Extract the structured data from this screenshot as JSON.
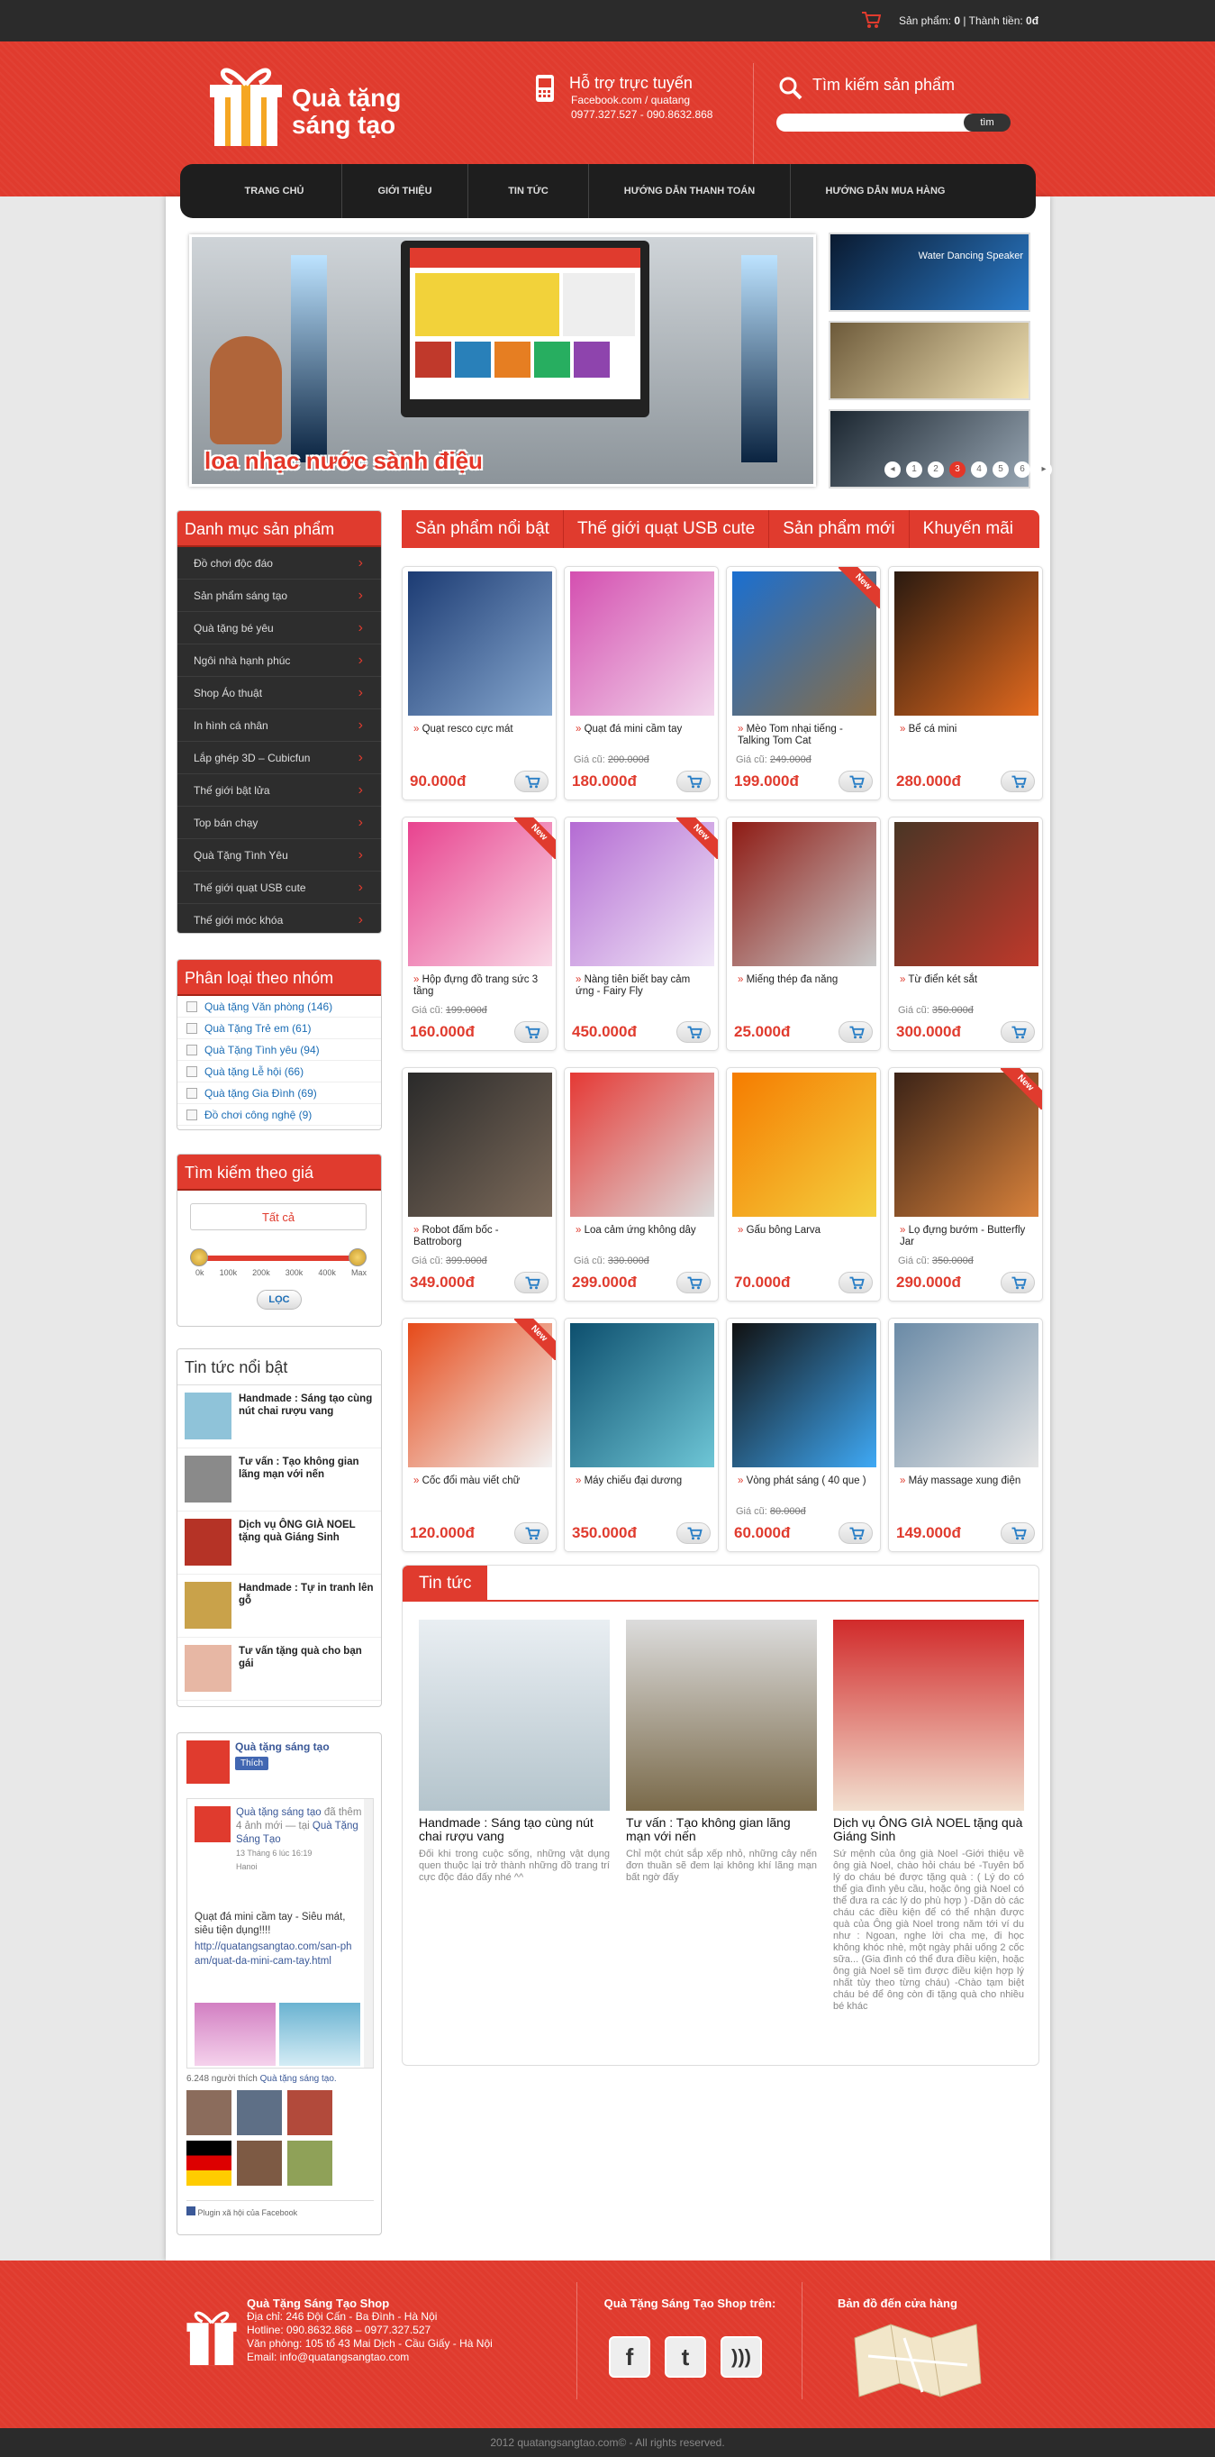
{
  "topbar": {
    "cart_label": "Sản phẩm:",
    "cart_count": "0",
    "total_label": "Thành tiền:",
    "total_value": "0đ"
  },
  "header": {
    "logo_line1": "Quà tặng",
    "logo_line2": "sáng tạo",
    "support_title": "Hỗ trợ trực tuyến",
    "support_fb": "Facebook.com / quatang",
    "support_phone": "0977.327.527 - 090.8632.868",
    "search_title": "Tìm kiếm sản phẩm",
    "search_button": "tìm"
  },
  "nav": [
    "TRANG CHỦ",
    "GIỚI THIỆU",
    "TIN TỨC",
    "HƯỚNG DẪN THANH TOÁN",
    "HƯỚNG DẪN MUA HÀNG"
  ],
  "slider": {
    "caption": "loa nhạc nước sành điệu",
    "thumb1": "Water Dancing Speaker",
    "pages": [
      "1",
      "2",
      "3",
      "4",
      "5",
      "6"
    ],
    "active": "3"
  },
  "sidebar": {
    "cat_title": "Danh mục sản phẩm",
    "categories": [
      "Đồ chơi độc đáo",
      "Sản phẩm sáng tạo",
      "Quà tặng bé yêu",
      "Ngôi nhà hạnh phúc",
      "Shop Áo thuật",
      "In hình cá nhân",
      "Lắp ghép 3D – Cubicfun",
      "Thế giới bật lửa",
      "Top bán chạy",
      "Quà Tặng Tình Yêu",
      "Thế giới quạt USB cute",
      "Thế giới móc khóa"
    ],
    "group_title": "Phân loại theo nhóm",
    "groups": [
      "Quà tặng Văn phòng (146)",
      "Quà Tặng Trẻ em (61)",
      "Quà Tặng Tình yêu (94)",
      "Quà tặng Lễ hội (66)",
      "Quà tặng Gia Đình (69)",
      "Đồ chơi công nghệ (9)"
    ],
    "price_title": "Tìm kiếm theo giá",
    "price_all": "Tất cả",
    "price_ticks": [
      "0k",
      "100k",
      "200k",
      "300k",
      "400k",
      "Max"
    ],
    "price_button": "LỌC",
    "news_title": "Tin tức nổi bật",
    "news": [
      "Handmade : Sáng tạo cùng nút chai rượu vang",
      "Tư vấn : Tạo không gian lãng mạn với nến",
      "Dịch vụ ÔNG GIÀ NOEL tặng quà Giáng Sinh",
      "Handmade : Tự in tranh lên gỗ",
      "Tư vấn tặng quà cho bạn gái"
    ]
  },
  "facebook": {
    "page_name": "Quà tặng sáng tạo",
    "like": "Thích",
    "post_author": "Quà tặng sáng tạo",
    "post_meta": "đã thêm 4 ảnh mới — tại",
    "post_place": "Quà Tặng Sáng Tạo",
    "post_date": "13 Tháng 6 lúc 16:19",
    "post_loc": "Hanoi",
    "post_text": "Quạt đá mini cầm tay - Siêu mát, siêu tiện dụng!!!!",
    "post_link": "http://quatangsangtao.com/san-pham/quat-da-mini-cam-tay.html",
    "likes_text": "6.248 người thích",
    "likes_link": "Quà tặng sáng tạo.",
    "plugin": "Plugin xã hội của Facebook"
  },
  "tabs": [
    "Sản phẩm nổi bật",
    "Thế giới quạt USB cute",
    "Sản phẩm mới",
    "Khuyến mãi"
  ],
  "products": [
    {
      "name": "Quạt resco cực mát",
      "old_label": "",
      "old": "",
      "price": "90.000đ",
      "new": false,
      "c1": "#1c3b73",
      "c2": "#87a8cf"
    },
    {
      "name": "Quạt đá mini cầm tay",
      "old_label": "Giá cũ:",
      "old": "200.000đ",
      "price": "180.000đ",
      "new": false,
      "c1": "#d44fb0",
      "c2": "#f2d6ec"
    },
    {
      "name": "Mèo Tom nhại tiếng - Talking Tom Cat",
      "old_label": "Giá cũ:",
      "old": "249.000đ",
      "price": "199.000đ",
      "new": true,
      "c1": "#1a6fd1",
      "c2": "#8b6d44"
    },
    {
      "name": "Bể cá mini",
      "old_label": "",
      "old": "",
      "price": "280.000đ",
      "new": false,
      "c1": "#2a1a10",
      "c2": "#e36a1e"
    },
    {
      "name": "Hộp đựng đồ trang sức 3 tầng",
      "old_label": "Giá cũ:",
      "old": "199.000đ",
      "price": "160.000đ",
      "new": true,
      "c1": "#e8438f",
      "c2": "#f9d9e7"
    },
    {
      "name": "Nàng tiên biết bay cảm ứng - Fairy Fly",
      "old_label": "",
      "old": "",
      "price": "450.000đ",
      "new": true,
      "c1": "#b46bd3",
      "c2": "#f0e7f7"
    },
    {
      "name": "Miếng thép đa năng",
      "old_label": "",
      "old": "",
      "price": "25.000đ",
      "new": false,
      "c1": "#8e1b14",
      "c2": "#c9c9c9"
    },
    {
      "name": "Từ điển két sắt",
      "old_label": "Giá cũ:",
      "old": "350.000đ",
      "price": "300.000đ",
      "new": false,
      "c1": "#4a3625",
      "c2": "#c0392b"
    },
    {
      "name": "Robot đấm bốc - Battroborg",
      "old_label": "Giá cũ:",
      "old": "399.000đ",
      "price": "349.000đ",
      "new": false,
      "c1": "#2a2a2a",
      "c2": "#7c6a5a"
    },
    {
      "name": "Loa cảm ứng không dây",
      "old_label": "Giá cũ:",
      "old": "330.000đ",
      "price": "299.000đ",
      "new": false,
      "c1": "#e53935",
      "c2": "#dcdcdc"
    },
    {
      "name": "Gấu bông Larva",
      "old_label": "",
      "old": "",
      "price": "70.000đ",
      "new": false,
      "c1": "#f57c00",
      "c2": "#f4d03f"
    },
    {
      "name": "Lọ đựng bướm - Butterfly Jar",
      "old_label": "Giá cũ:",
      "old": "350.000đ",
      "price": "290.000đ",
      "new": true,
      "c1": "#3b2317",
      "c2": "#d9823b"
    },
    {
      "name": "Cốc đổi màu viết chữ",
      "old_label": "",
      "old": "",
      "price": "120.000đ",
      "new": true,
      "c1": "#e64a19",
      "c2": "#f2f2f2"
    },
    {
      "name": "Máy chiếu đại dương",
      "old_label": "",
      "old": "",
      "price": "350.000đ",
      "new": false,
      "c1": "#0d4f6e",
      "c2": "#6ec6d6"
    },
    {
      "name": "Vòng phát sáng ( 40 que )",
      "old_label": "Giá cũ:",
      "old": "80.000đ",
      "price": "60.000đ",
      "new": false,
      "c1": "#111",
      "c2": "#3fa9f5"
    },
    {
      "name": "Máy massage xung điện",
      "old_label": "",
      "old": "",
      "price": "149.000đ",
      "new": false,
      "c1": "#6a8aa6",
      "c2": "#e5e5e5"
    }
  ],
  "news_section": {
    "tab": "Tin tức",
    "items": [
      {
        "title": "Handmade : Sáng tạo cùng nút chai rượu vang",
        "desc": "Đối khi trong cuộc sống, những vật dụng quen thuộc lại trở thành những đồ trang trí cực độc đáo đấy nhé ^^"
      },
      {
        "title": "Tư vấn : Tạo không gian lãng mạn với nến",
        "desc": "Chỉ một chút sắp xếp nhỏ, những cây nến đơn thuần sẽ đem lại không khí lãng mạn bất ngờ đấy"
      },
      {
        "title": "Dịch vụ ÔNG GIÀ NOEL tặng quà Giáng Sinh",
        "desc": "Sứ mệnh của ông già Noel -Giới thiệu về ông già Noel, chào hỏi cháu bé -Tuyên bố lý do cháu bé được tặng quà : ( Lý do có thể gia đình yêu cầu, hoặc ông già Noel có thể đưa ra các lý do phù hợp ) -Dặn dò các cháu các điều kiện để có thể nhận được quà của Ông già Noel trong năm tới ví du như : Ngoan, nghe lời cha mẹ, đi học không khóc nhè, một ngày phải uống 2 cốc sữa... (Gia đình có thể đưa điều kiện, hoặc ông già Noel sẽ tìm được điều kiện hợp lý nhất tùy theo từng cháu) -Chào tạm biệt cháu bé để ông còn đi tặng quà cho nhiều bé khác"
      }
    ]
  },
  "footer": {
    "shop": "Quà Tặng Sáng Tạo Shop",
    "addr": "Địa chỉ: 246 Đội Cấn - Ba Đình - Hà Nội",
    "hotline": "Hotline: 090.8632.868 – 0977.327.527",
    "office": "Văn phòng: 105 tổ 43 Mai Dịch - Cầu Giấy - Hà Nội",
    "email": "Email: info@quatangsangtao.com",
    "social_title": "Quà Tặng Sáng Tạo Shop trên:",
    "map_title": "Bản đồ đến cửa hàng",
    "copyright": "2012 quatangsangtao.com© - All rights reserved."
  },
  "colors": {
    "brand": "#e03b2e",
    "dark": "#2b2b2b"
  }
}
